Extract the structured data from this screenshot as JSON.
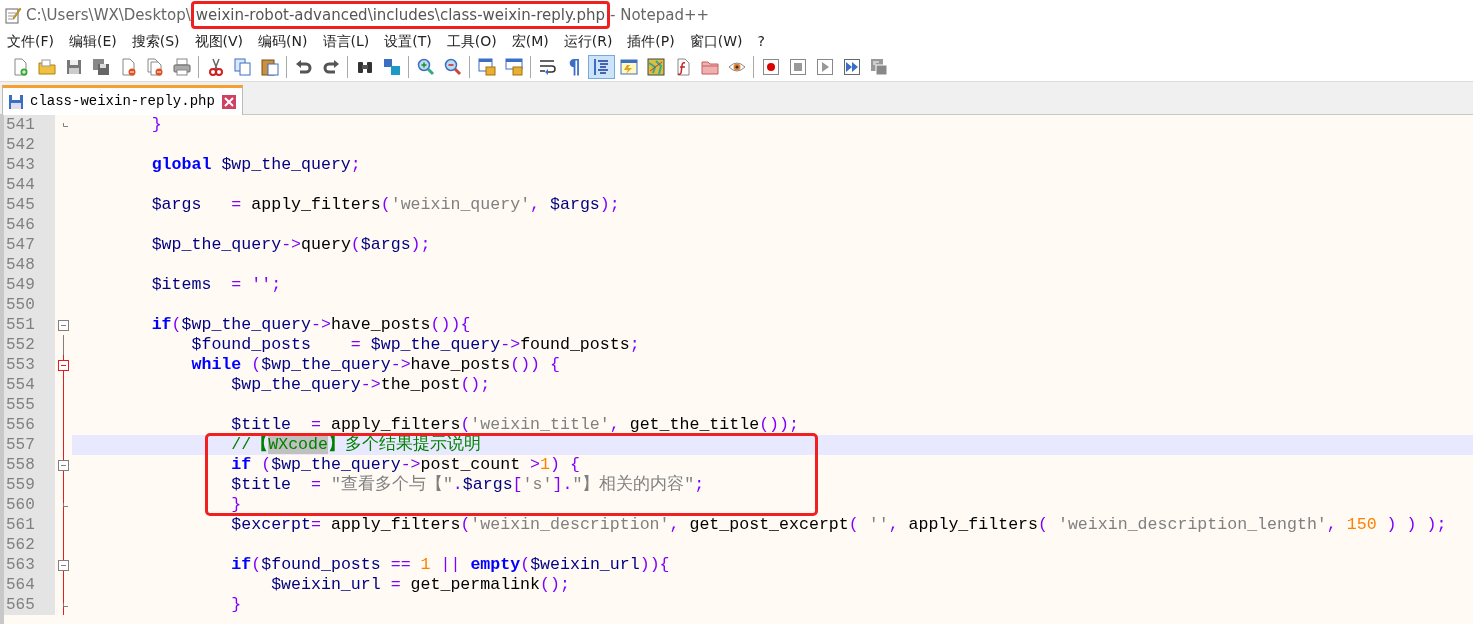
{
  "window": {
    "title_parts": [
      {
        "text": "C:\\Users\\WX\\Desktop\\",
        "marked": false
      },
      {
        "text": "weixin-robot-advanced\\includes\\class-weixin-reply.php",
        "marked": true
      },
      {
        "text": " - Notepad++",
        "marked": false
      }
    ]
  },
  "menu": [
    "文件(F)",
    "编辑(E)",
    "搜索(S)",
    "视图(V)",
    "编码(N)",
    "语言(L)",
    "设置(T)",
    "工具(O)",
    "宏(M)",
    "运行(R)",
    "插件(P)",
    "窗口(W)",
    "?"
  ],
  "toolbar_groups": [
    [
      {
        "on": false
      },
      {
        "on": false
      },
      {
        "on": false
      },
      {
        "on": false
      },
      {
        "on": false
      },
      {
        "on": false
      },
      {
        "on": false
      }
    ],
    [
      {
        "on": false
      },
      {
        "on": false
      },
      {
        "on": false
      }
    ],
    [
      {
        "on": false
      },
      {
        "on": false
      }
    ],
    [
      {
        "on": false
      },
      {
        "on": false
      }
    ],
    [
      {
        "on": false
      },
      {
        "on": false
      }
    ],
    [
      {
        "on": false
      },
      {
        "on": false
      }
    ],
    [
      {
        "on": false
      },
      {
        "on": false,
        "text": "¶"
      },
      {
        "on": true
      },
      {
        "on": false
      },
      {
        "on": false
      },
      {
        "on": false
      },
      {
        "on": false
      },
      {
        "on": false
      }
    ],
    [
      {
        "on": false
      },
      {
        "on": false
      },
      {
        "on": false
      },
      {
        "on": false
      },
      {
        "on": false
      }
    ]
  ],
  "tabs": [
    {
      "label": "class-weixin-reply.php",
      "selected": true
    }
  ],
  "editor": {
    "lines": [
      {
        "number": "541",
        "fold": {
          "kind": "end"
        },
        "in_scope": false,
        "current": false,
        "marked": false,
        "tokens": [
          {
            "kind": "op",
            "text": "        }"
          }
        ]
      },
      {
        "number": "542",
        "in_scope": false,
        "current": false,
        "marked": false
      },
      {
        "number": "543",
        "in_scope": false,
        "current": false,
        "marked": false,
        "tokens": [
          {
            "kind": "kw",
            "text": "        global"
          },
          {
            "kind": "var",
            "text": " $wp_the_query"
          },
          {
            "kind": "op",
            "text": ";"
          }
        ]
      },
      {
        "number": "544",
        "in_scope": false,
        "current": false,
        "marked": false
      },
      {
        "number": "545",
        "in_scope": false,
        "current": false,
        "marked": false,
        "tokens": [
          {
            "kind": "var",
            "text": "        $args"
          },
          {
            "kind": "op",
            "text": "   ="
          },
          {
            "kind": "plain",
            "text": " apply_filters"
          },
          {
            "kind": "op",
            "text": "("
          },
          {
            "kind": "str",
            "text": "'weixin_query'"
          },
          {
            "kind": "op",
            "text": ","
          },
          {
            "kind": "var",
            "text": " $args"
          },
          {
            "kind": "op",
            "text": ");"
          }
        ]
      },
      {
        "number": "546",
        "in_scope": false,
        "current": false,
        "marked": false
      },
      {
        "number": "547",
        "in_scope": false,
        "current": false,
        "marked": false,
        "tokens": [
          {
            "kind": "var",
            "text": "        $wp_the_query"
          },
          {
            "kind": "op",
            "text": "->"
          },
          {
            "kind": "plain",
            "text": "query"
          },
          {
            "kind": "op",
            "text": "("
          },
          {
            "kind": "var",
            "text": "$args"
          },
          {
            "kind": "op",
            "text": ");"
          }
        ]
      },
      {
        "number": "548",
        "in_scope": false,
        "current": false,
        "marked": false
      },
      {
        "number": "549",
        "in_scope": false,
        "current": false,
        "marked": false,
        "tokens": [
          {
            "kind": "var",
            "text": "        $items"
          },
          {
            "kind": "op",
            "text": "  = '';"
          }
        ]
      },
      {
        "number": "550",
        "in_scope": false,
        "current": false,
        "marked": false
      },
      {
        "number": "551",
        "fold": {
          "kind": "open"
        },
        "in_scope": false,
        "current": false,
        "marked": false,
        "tokens": [
          {
            "kind": "kw",
            "text": "        if"
          },
          {
            "kind": "op",
            "text": "("
          },
          {
            "kind": "var",
            "text": "$wp_the_query"
          },
          {
            "kind": "op",
            "text": "->"
          },
          {
            "kind": "plain",
            "text": "have_posts"
          },
          {
            "kind": "op",
            "text": "()){"
          }
        ]
      },
      {
        "number": "552",
        "fold": {
          "kind": "line"
        },
        "in_scope": false,
        "current": false,
        "marked": false,
        "tokens": [
          {
            "kind": "var",
            "text": "            $found_posts"
          },
          {
            "kind": "op",
            "text": "    = "
          },
          {
            "kind": "var",
            "text": "$wp_the_query"
          },
          {
            "kind": "op",
            "text": "->"
          },
          {
            "kind": "plain",
            "text": "found_posts"
          },
          {
            "kind": "op",
            "text": ";"
          }
        ]
      },
      {
        "number": "553",
        "fold": {
          "kind": "head"
        },
        "in_scope": true,
        "current": false,
        "marked": false,
        "tokens": [
          {
            "kind": "kw",
            "text": "            while"
          },
          {
            "kind": "op",
            "text": " ("
          },
          {
            "kind": "var",
            "text": "$wp_the_query"
          },
          {
            "kind": "op",
            "text": "->"
          },
          {
            "kind": "plain",
            "text": "have_posts"
          },
          {
            "kind": "op",
            "text": "()) {"
          }
        ]
      },
      {
        "number": "554",
        "in_scope": true,
        "current": false,
        "marked": false,
        "tokens": [
          {
            "kind": "var",
            "text": "                $wp_the_query"
          },
          {
            "kind": "op",
            "text": "->"
          },
          {
            "kind": "plain",
            "text": "the_post"
          },
          {
            "kind": "op",
            "text": "();"
          }
        ]
      },
      {
        "number": "555",
        "in_scope": true,
        "current": false,
        "marked": false
      },
      {
        "number": "556",
        "in_scope": true,
        "current": false,
        "marked": false,
        "tokens": [
          {
            "kind": "var",
            "text": "                $title"
          },
          {
            "kind": "op",
            "text": "  = "
          },
          {
            "kind": "plain",
            "text": "apply_filters"
          },
          {
            "kind": "op",
            "text": "("
          },
          {
            "kind": "str",
            "text": "'weixin_title'"
          },
          {
            "kind": "op",
            "text": ","
          },
          {
            "kind": "plain",
            "text": " get_the_title"
          },
          {
            "kind": "op",
            "text": "());"
          }
        ]
      },
      {
        "number": "557",
        "in_scope": true,
        "current": true,
        "marked": true,
        "tokens": [
          {
            "kind": "cmt",
            "text": "                //"
          },
          {
            "kind": "cmtb",
            "text": "【"
          },
          {
            "kind": "hl",
            "text": "WXcode"
          },
          {
            "kind": "cmtb",
            "text": "】"
          },
          {
            "kind": "cmt",
            "text": "多个结果提示说明"
          }
        ]
      },
      {
        "number": "558",
        "fold": {
          "kind": "open"
        },
        "in_scope": true,
        "current": false,
        "marked": true,
        "tokens": [
          {
            "kind": "kw",
            "text": "                if"
          },
          {
            "kind": "op",
            "text": " ("
          },
          {
            "kind": "var",
            "text": "$wp_the_query"
          },
          {
            "kind": "op",
            "text": "->"
          },
          {
            "kind": "plain",
            "text": "post_count"
          },
          {
            "kind": "op",
            "text": " >"
          },
          {
            "kind": "num",
            "text": "1"
          },
          {
            "kind": "op",
            "text": ") {"
          }
        ]
      },
      {
        "number": "559",
        "in_scope": true,
        "current": false,
        "marked": true,
        "tokens": [
          {
            "kind": "var",
            "text": "                $title"
          },
          {
            "kind": "op",
            "text": "  = "
          },
          {
            "kind": "str",
            "text": "\"查看多个与【\""
          },
          {
            "kind": "op",
            "text": "."
          },
          {
            "kind": "var",
            "text": "$args"
          },
          {
            "kind": "op",
            "text": "["
          },
          {
            "kind": "str",
            "text": "'s'"
          },
          {
            "kind": "op",
            "text": "]."
          },
          {
            "kind": "str",
            "text": "\"】相关的内容\""
          },
          {
            "kind": "op",
            "text": ";"
          }
        ]
      },
      {
        "number": "560",
        "fold": {
          "kind": "end"
        },
        "in_scope": true,
        "current": false,
        "marked": true,
        "tokens": [
          {
            "kind": "op",
            "text": "                }"
          }
        ]
      },
      {
        "number": "561",
        "in_scope": true,
        "current": false,
        "marked": false,
        "tokens": [
          {
            "kind": "var",
            "text": "                $excerpt"
          },
          {
            "kind": "op",
            "text": "="
          },
          {
            "kind": "plain",
            "text": " apply_filters"
          },
          {
            "kind": "op",
            "text": "("
          },
          {
            "kind": "str",
            "text": "'weixin_description'"
          },
          {
            "kind": "op",
            "text": ","
          },
          {
            "kind": "plain",
            "text": " get_post_excerpt"
          },
          {
            "kind": "op",
            "text": "("
          },
          {
            "kind": "str",
            "text": " ''"
          },
          {
            "kind": "op",
            "text": ","
          },
          {
            "kind": "plain",
            "text": " apply_filters"
          },
          {
            "kind": "op",
            "text": "("
          },
          {
            "kind": "str",
            "text": " 'weixin_description_length'"
          },
          {
            "kind": "op",
            "text": ","
          },
          {
            "kind": "num",
            "text": " 150"
          },
          {
            "kind": "op",
            "text": " ) ) );"
          }
        ]
      },
      {
        "number": "562",
        "in_scope": true,
        "current": false,
        "marked": false
      },
      {
        "number": "563",
        "fold": {
          "kind": "open"
        },
        "in_scope": true,
        "current": false,
        "marked": false,
        "tokens": [
          {
            "kind": "kw",
            "text": "                if"
          },
          {
            "kind": "op",
            "text": "("
          },
          {
            "kind": "var",
            "text": "$found_posts"
          },
          {
            "kind": "op",
            "text": " == "
          },
          {
            "kind": "num",
            "text": "1"
          },
          {
            "kind": "op",
            "text": " || "
          },
          {
            "kind": "kw",
            "text": "empty"
          },
          {
            "kind": "op",
            "text": "("
          },
          {
            "kind": "var",
            "text": "$weixin_url"
          },
          {
            "kind": "op",
            "text": ")){"
          }
        ]
      },
      {
        "number": "564",
        "in_scope": true,
        "current": false,
        "marked": false,
        "tokens": [
          {
            "kind": "var",
            "text": "                    $weixin_url"
          },
          {
            "kind": "op",
            "text": " = "
          },
          {
            "kind": "plain",
            "text": "get_permalink"
          },
          {
            "kind": "op",
            "text": "();"
          }
        ]
      },
      {
        "number": "565",
        "fold": {
          "kind": "end"
        },
        "in_scope": true,
        "current": false,
        "marked": false,
        "tokens": [
          {
            "kind": "op",
            "text": "                }"
          }
        ]
      }
    ]
  }
}
